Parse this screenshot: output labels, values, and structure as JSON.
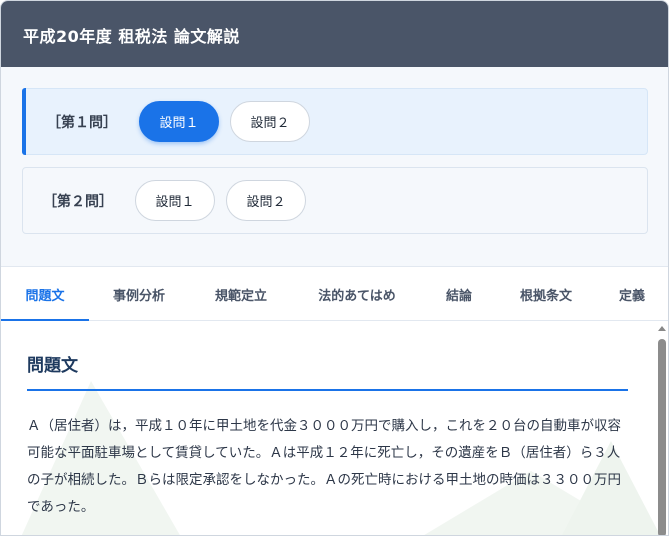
{
  "header": {
    "title": "平成20年度 租税法 論文解説"
  },
  "questions": [
    {
      "label": "［第１問］",
      "subs": [
        {
          "label": "設問１",
          "selected": true
        },
        {
          "label": "設問２",
          "selected": false
        }
      ]
    },
    {
      "label": "［第２問］",
      "subs": [
        {
          "label": "設問１",
          "selected": false
        },
        {
          "label": "設問２",
          "selected": false
        }
      ]
    }
  ],
  "tabs": [
    {
      "label": "問題文",
      "active": true
    },
    {
      "label": "事例分析",
      "active": false
    },
    {
      "label": "規範定立",
      "active": false
    },
    {
      "label": "法的あてはめ",
      "active": false
    },
    {
      "label": "結論",
      "active": false
    },
    {
      "label": "根拠条文",
      "active": false
    },
    {
      "label": "定義",
      "active": false
    }
  ],
  "content": {
    "title": "問題文",
    "paragraph": "Ａ（居住者）は，平成１０年に甲土地を代金３０００万円で購入し，これを２０台の自動車が収容可能な平面駐車場として賃貸していた。Ａは平成１２年に死亡し，その遺産をＢ（居住者）ら３人の子が相続した。Ｂらは限定承認をしなかった。Ａの死亡時における甲土地の時価は３３００万円であった。"
  },
  "colors": {
    "accent": "#1a73e8",
    "header_bg": "#4a5568"
  }
}
